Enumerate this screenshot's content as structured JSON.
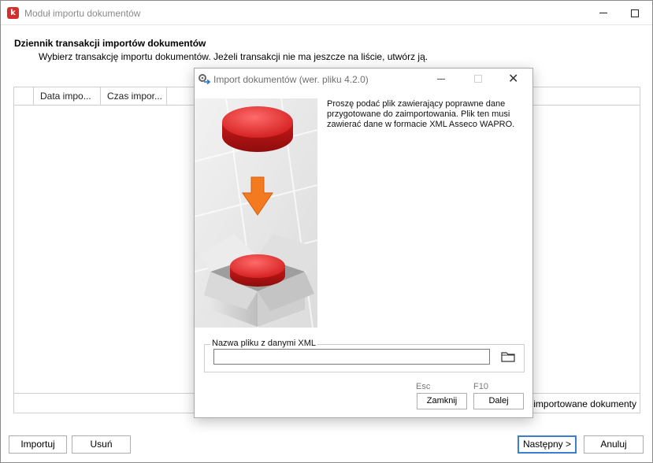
{
  "window": {
    "title": "Moduł importu dokumentów",
    "app_icon_letter": "k"
  },
  "header": {
    "title": "Dziennik transakcji importów dokumentów",
    "description": "Wybierz transakcję importu dokumentów. Jeżeli transakcji nie ma jeszcze na liście, utwórz ją."
  },
  "grid": {
    "columns": [
      "Data impo...",
      "Czas impor..."
    ],
    "footer_label": "importowane dokumenty"
  },
  "buttons": {
    "importuj": "Importuj",
    "usun": "Usuń",
    "nastepny": "Następny >",
    "anuluj": "Anuluj"
  },
  "dialog": {
    "title": "Import dokumentów (wer. pliku 4.2.0)",
    "info": "Proszę podać plik zawierający poprawne dane przygotowane do zaimportowania. Plik ten musi zawierać dane w formacie XML Asseco WAPRO.",
    "file_group_label": "Nazwa pliku z danymi XML",
    "file_value": "",
    "hint_esc": "Esc",
    "hint_f10": "F10",
    "btn_zamknij": "Zamknij",
    "btn_dalej": "Dalej"
  },
  "icons": {
    "folder": "folder-icon",
    "gear": "gear-arrow-icon",
    "close": "close-icon"
  }
}
